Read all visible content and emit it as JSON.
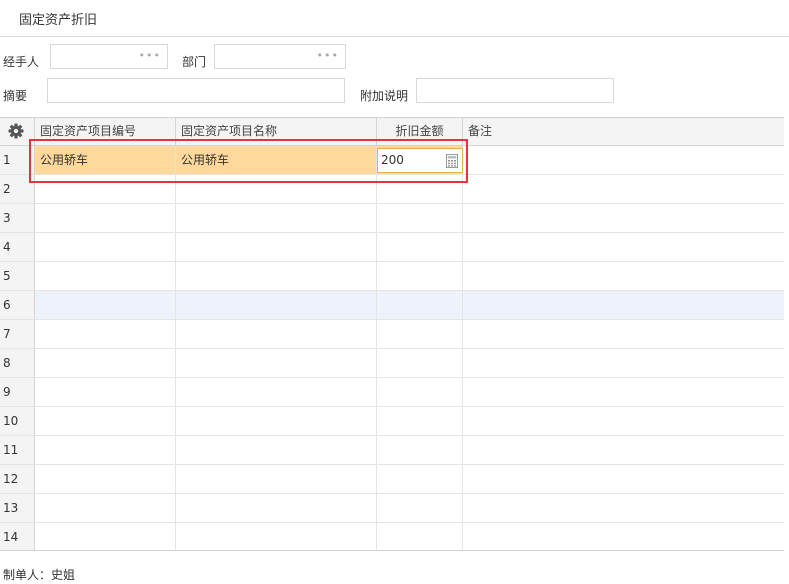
{
  "page": {
    "title": "固定资产折旧"
  },
  "form": {
    "handler_label": "经手人",
    "handler_value": "",
    "department_label": "部门",
    "department_value": "",
    "summary_label": "摘要",
    "summary_value": "",
    "note_label": "附加说明",
    "note_value": ""
  },
  "grid": {
    "columns": [
      "固定资产项目编号",
      "固定资产项目名称",
      "折旧金额",
      "备注"
    ],
    "row_numbers": [
      "1",
      "2",
      "3",
      "4",
      "5",
      "6",
      "7",
      "8",
      "9",
      "10",
      "11",
      "12",
      "13",
      "14"
    ],
    "rows": [
      {
        "code": "公用轿车",
        "name": "公用轿车",
        "amount": "200",
        "remark": ""
      },
      {
        "code": "",
        "name": "",
        "amount": "",
        "remark": ""
      },
      {
        "code": "",
        "name": "",
        "amount": "",
        "remark": ""
      },
      {
        "code": "",
        "name": "",
        "amount": "",
        "remark": ""
      },
      {
        "code": "",
        "name": "",
        "amount": "",
        "remark": ""
      },
      {
        "code": "",
        "name": "",
        "amount": "",
        "remark": ""
      },
      {
        "code": "",
        "name": "",
        "amount": "",
        "remark": ""
      },
      {
        "code": "",
        "name": "",
        "amount": "",
        "remark": ""
      },
      {
        "code": "",
        "name": "",
        "amount": "",
        "remark": ""
      },
      {
        "code": "",
        "name": "",
        "amount": "",
        "remark": ""
      },
      {
        "code": "",
        "name": "",
        "amount": "",
        "remark": ""
      },
      {
        "code": "",
        "name": "",
        "amount": "",
        "remark": ""
      },
      {
        "code": "",
        "name": "",
        "amount": "",
        "remark": ""
      },
      {
        "code": "",
        "name": "",
        "amount": "",
        "remark": ""
      }
    ],
    "selected_row_color": "#ffd99c",
    "hover_row_color": "#eef3fb"
  },
  "icons": {
    "settings": "gear-icon",
    "lookup": "ellipsis-icon",
    "calculator": "calculator-icon"
  },
  "highlight_color": "#e8323c",
  "footer": {
    "creator_label": "制单人：史姐"
  }
}
